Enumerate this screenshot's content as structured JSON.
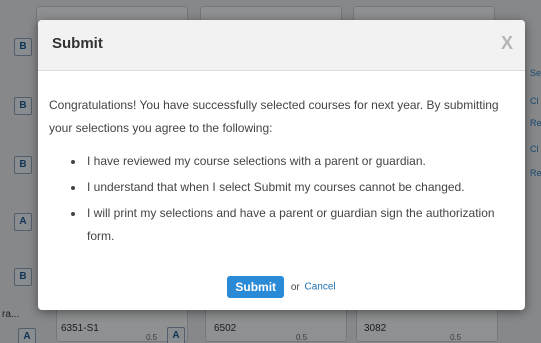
{
  "background": {
    "course_badges": [
      "B",
      "B",
      "B",
      "A",
      "B",
      "A",
      "A"
    ],
    "course_codes": [
      "6351-S1",
      "6502",
      "3082"
    ],
    "course_credits": [
      "0.5",
      "0.5",
      "0.5"
    ],
    "right_snippets": [
      "Se",
      "Cl",
      "Re",
      "Cl",
      "Re"
    ],
    "left_snippet": "ra..."
  },
  "modal": {
    "title": "Submit",
    "close_glyph": "X",
    "intro": "Congratulations! You have successfully selected courses for next year. By submitting your selections you agree to the following:",
    "terms": [
      "I have reviewed my course selections with a parent or guardian.",
      "I understand that when I select Submit my courses cannot be changed.",
      "I will print my selections and have a parent or guardian sign the authorization form."
    ],
    "submit_label": "Submit",
    "or_text": "or",
    "cancel_label": "Cancel"
  },
  "colors": {
    "primary_button": "#2a8ad6",
    "link": "#1f6fb2"
  }
}
